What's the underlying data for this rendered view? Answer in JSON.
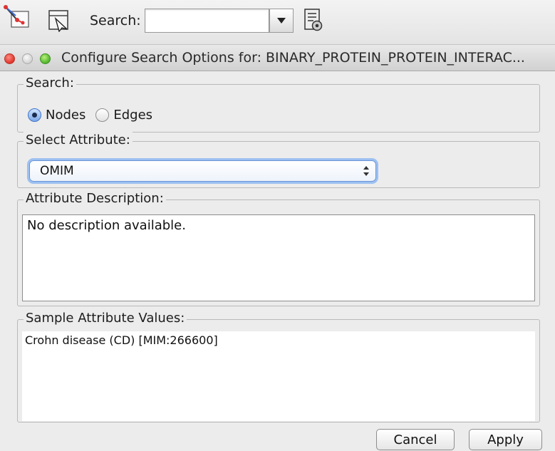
{
  "toolbar": {
    "search_label": "Search:",
    "search_value": "",
    "icons": [
      "network-icon",
      "select-icon",
      "dropdown-arrow-icon",
      "document-settings-icon"
    ]
  },
  "window": {
    "title": "Configure Search Options for:  BINARY_PROTEIN_PROTEIN_INTERAC..."
  },
  "search_group": {
    "label": "Search:",
    "options": [
      {
        "label": "Nodes",
        "checked": true
      },
      {
        "label": "Edges",
        "checked": false
      }
    ]
  },
  "attribute_group": {
    "label": "Select Attribute:",
    "selected": "OMIM"
  },
  "description_group": {
    "label": "Attribute Description:",
    "text": "No description available."
  },
  "sample_group": {
    "label": "Sample Attribute Values:",
    "values": [
      "Crohn disease (CD) [MIM:266600]"
    ]
  },
  "buttons": {
    "cancel": "Cancel",
    "apply": "Apply"
  },
  "colors": {
    "accent": "#6b95d6",
    "close": "#e0332a",
    "maximize": "#4fb52c"
  }
}
